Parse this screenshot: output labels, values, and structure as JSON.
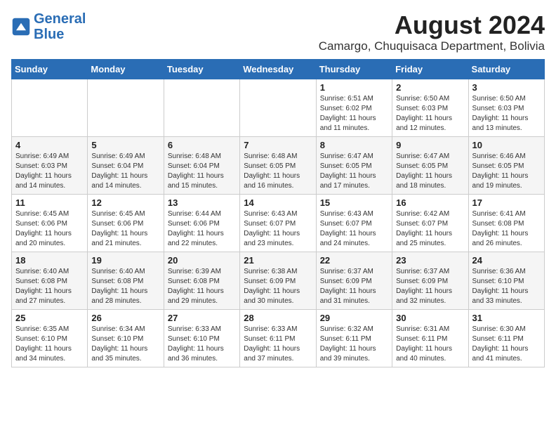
{
  "logo": {
    "line1": "General",
    "line2": "Blue"
  },
  "title": "August 2024",
  "subtitle": "Camargo, Chuquisaca Department, Bolivia",
  "weekdays": [
    "Sunday",
    "Monday",
    "Tuesday",
    "Wednesday",
    "Thursday",
    "Friday",
    "Saturday"
  ],
  "weeks": [
    [
      {
        "date": "",
        "info": ""
      },
      {
        "date": "",
        "info": ""
      },
      {
        "date": "",
        "info": ""
      },
      {
        "date": "",
        "info": ""
      },
      {
        "date": "1",
        "info": "Sunrise: 6:51 AM\nSunset: 6:02 PM\nDaylight: 11 hours and 11 minutes."
      },
      {
        "date": "2",
        "info": "Sunrise: 6:50 AM\nSunset: 6:03 PM\nDaylight: 11 hours and 12 minutes."
      },
      {
        "date": "3",
        "info": "Sunrise: 6:50 AM\nSunset: 6:03 PM\nDaylight: 11 hours and 13 minutes."
      }
    ],
    [
      {
        "date": "4",
        "info": "Sunrise: 6:49 AM\nSunset: 6:03 PM\nDaylight: 11 hours and 14 minutes."
      },
      {
        "date": "5",
        "info": "Sunrise: 6:49 AM\nSunset: 6:04 PM\nDaylight: 11 hours and 14 minutes."
      },
      {
        "date": "6",
        "info": "Sunrise: 6:48 AM\nSunset: 6:04 PM\nDaylight: 11 hours and 15 minutes."
      },
      {
        "date": "7",
        "info": "Sunrise: 6:48 AM\nSunset: 6:05 PM\nDaylight: 11 hours and 16 minutes."
      },
      {
        "date": "8",
        "info": "Sunrise: 6:47 AM\nSunset: 6:05 PM\nDaylight: 11 hours and 17 minutes."
      },
      {
        "date": "9",
        "info": "Sunrise: 6:47 AM\nSunset: 6:05 PM\nDaylight: 11 hours and 18 minutes."
      },
      {
        "date": "10",
        "info": "Sunrise: 6:46 AM\nSunset: 6:05 PM\nDaylight: 11 hours and 19 minutes."
      }
    ],
    [
      {
        "date": "11",
        "info": "Sunrise: 6:45 AM\nSunset: 6:06 PM\nDaylight: 11 hours and 20 minutes."
      },
      {
        "date": "12",
        "info": "Sunrise: 6:45 AM\nSunset: 6:06 PM\nDaylight: 11 hours and 21 minutes."
      },
      {
        "date": "13",
        "info": "Sunrise: 6:44 AM\nSunset: 6:06 PM\nDaylight: 11 hours and 22 minutes."
      },
      {
        "date": "14",
        "info": "Sunrise: 6:43 AM\nSunset: 6:07 PM\nDaylight: 11 hours and 23 minutes."
      },
      {
        "date": "15",
        "info": "Sunrise: 6:43 AM\nSunset: 6:07 PM\nDaylight: 11 hours and 24 minutes."
      },
      {
        "date": "16",
        "info": "Sunrise: 6:42 AM\nSunset: 6:07 PM\nDaylight: 11 hours and 25 minutes."
      },
      {
        "date": "17",
        "info": "Sunrise: 6:41 AM\nSunset: 6:08 PM\nDaylight: 11 hours and 26 minutes."
      }
    ],
    [
      {
        "date": "18",
        "info": "Sunrise: 6:40 AM\nSunset: 6:08 PM\nDaylight: 11 hours and 27 minutes."
      },
      {
        "date": "19",
        "info": "Sunrise: 6:40 AM\nSunset: 6:08 PM\nDaylight: 11 hours and 28 minutes."
      },
      {
        "date": "20",
        "info": "Sunrise: 6:39 AM\nSunset: 6:08 PM\nDaylight: 11 hours and 29 minutes."
      },
      {
        "date": "21",
        "info": "Sunrise: 6:38 AM\nSunset: 6:09 PM\nDaylight: 11 hours and 30 minutes."
      },
      {
        "date": "22",
        "info": "Sunrise: 6:37 AM\nSunset: 6:09 PM\nDaylight: 11 hours and 31 minutes."
      },
      {
        "date": "23",
        "info": "Sunrise: 6:37 AM\nSunset: 6:09 PM\nDaylight: 11 hours and 32 minutes."
      },
      {
        "date": "24",
        "info": "Sunrise: 6:36 AM\nSunset: 6:10 PM\nDaylight: 11 hours and 33 minutes."
      }
    ],
    [
      {
        "date": "25",
        "info": "Sunrise: 6:35 AM\nSunset: 6:10 PM\nDaylight: 11 hours and 34 minutes."
      },
      {
        "date": "26",
        "info": "Sunrise: 6:34 AM\nSunset: 6:10 PM\nDaylight: 11 hours and 35 minutes."
      },
      {
        "date": "27",
        "info": "Sunrise: 6:33 AM\nSunset: 6:10 PM\nDaylight: 11 hours and 36 minutes."
      },
      {
        "date": "28",
        "info": "Sunrise: 6:33 AM\nSunset: 6:11 PM\nDaylight: 11 hours and 37 minutes."
      },
      {
        "date": "29",
        "info": "Sunrise: 6:32 AM\nSunset: 6:11 PM\nDaylight: 11 hours and 39 minutes."
      },
      {
        "date": "30",
        "info": "Sunrise: 6:31 AM\nSunset: 6:11 PM\nDaylight: 11 hours and 40 minutes."
      },
      {
        "date": "31",
        "info": "Sunrise: 6:30 AM\nSunset: 6:11 PM\nDaylight: 11 hours and 41 minutes."
      }
    ]
  ]
}
